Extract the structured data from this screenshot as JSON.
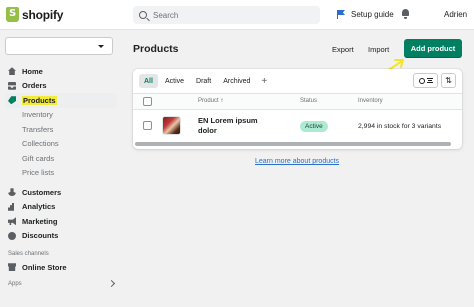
{
  "topbar": {
    "logo_text": "shopify",
    "search_placeholder": "Search",
    "setup_guide": "Setup guide",
    "user_name": "Adrien"
  },
  "sidebar": {
    "nav": [
      {
        "label": "Home",
        "icon": "home-icon"
      },
      {
        "label": "Orders",
        "icon": "orders-icon"
      },
      {
        "label": "Products",
        "icon": "tag-icon",
        "active": true
      }
    ],
    "product_sub": [
      "Inventory",
      "Transfers",
      "Collections",
      "Gift cards",
      "Price lists"
    ],
    "nav2": [
      {
        "label": "Customers",
        "icon": "person-icon"
      },
      {
        "label": "Analytics",
        "icon": "analytics-icon"
      },
      {
        "label": "Marketing",
        "icon": "megaphone-icon"
      },
      {
        "label": "Discounts",
        "icon": "discount-icon"
      }
    ],
    "sales_channels_title": "Sales channels",
    "online_store": "Online Store",
    "apps_title": "Apps"
  },
  "page": {
    "title": "Products",
    "export_label": "Export",
    "import_label": "Import",
    "add_product_label": "Add product"
  },
  "table": {
    "tabs": [
      "All",
      "Active",
      "Draft",
      "Archived"
    ],
    "add_tab": "+",
    "headers": {
      "product": "Product",
      "product_sort": "↑",
      "status": "Status",
      "inventory": "Inventory"
    },
    "rows": [
      {
        "name": "EN Lorem ipsum dolor",
        "status": "Active",
        "inventory": "2,994 in stock for 3 variants"
      }
    ]
  },
  "footer_link": "Learn more about products",
  "colors": {
    "primary": "#008060",
    "highlight": "#f2ea3c",
    "active_badge": "#aee9d1",
    "link": "#2c6ecb"
  }
}
